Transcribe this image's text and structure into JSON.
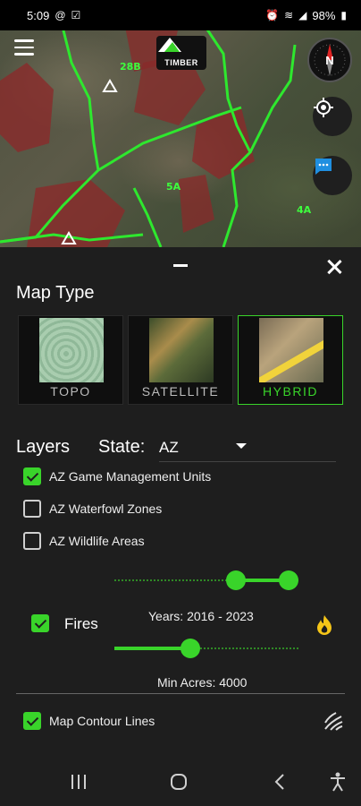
{
  "status": {
    "time": "5:09",
    "battery": "98%"
  },
  "map": {
    "logo_text": "TIMBER",
    "compass_label": "N",
    "labels": [
      "28B",
      "5A",
      "4A"
    ]
  },
  "panel": {
    "map_type_title": "Map Type",
    "map_types": [
      {
        "label": "TOPO",
        "selected": false
      },
      {
        "label": "SATELLITE",
        "selected": false
      },
      {
        "label": "HYBRID",
        "selected": true
      }
    ],
    "layers_title": "Layers",
    "state_label": "State:",
    "state_value": "AZ",
    "layers": [
      {
        "label": "AZ Game Management Units",
        "checked": true
      },
      {
        "label": "AZ Waterfowl Zones",
        "checked": false
      },
      {
        "label": "AZ Wildlife Areas",
        "checked": false
      }
    ],
    "fires": {
      "label": "Fires",
      "checked": true,
      "years_text": "Years: 2016 - 2023",
      "years_range_fraction": [
        0.68,
        1.0
      ],
      "min_acres_text": "Min Acres: 4000",
      "acres_fraction": 0.4
    },
    "contour": {
      "label": "Map Contour Lines",
      "checked": true
    }
  },
  "colors": {
    "accent": "#39d42a",
    "sheet_bg": "#1e1e1e",
    "fire": "#f5c518"
  }
}
